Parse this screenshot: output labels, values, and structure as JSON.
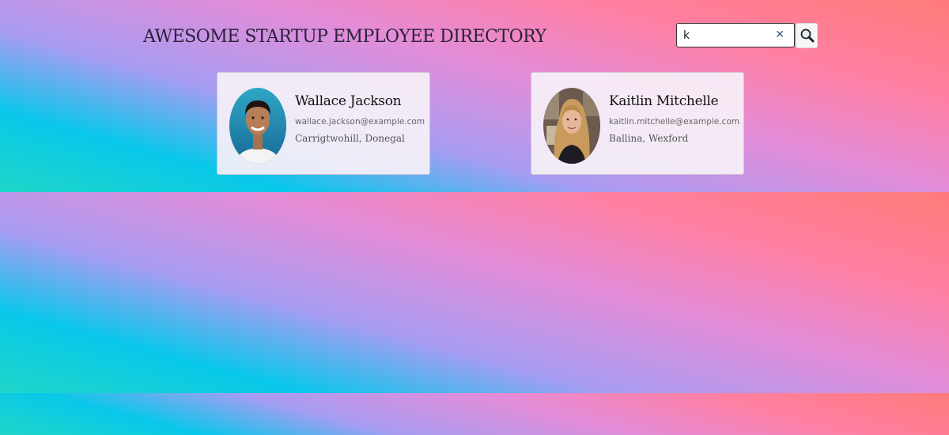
{
  "header": {
    "title": "AWESOME STARTUP EMPLOYEE DIRECTORY"
  },
  "search": {
    "value": "k",
    "placeholder": "",
    "clear_icon": "x-icon",
    "button_icon": "magnifier-icon"
  },
  "employees": [
    {
      "name": "Wallace Jackson",
      "email": "wallace.jackson@example.com",
      "location": "Carrigtwohill, Donegal"
    },
    {
      "name": "Kaitlin Mitchelle",
      "email": "kaitlin.mitchelle@example.com",
      "location": "Ballina, Wexford"
    }
  ],
  "colors": {
    "gradient": [
      "#1fd6c8",
      "#08c8ea",
      "#a79cf2",
      "#e48cd8",
      "#ff7fa2",
      "#ff7b79"
    ],
    "card_background": "#f6f0f7",
    "title_text": "#2a2238"
  }
}
